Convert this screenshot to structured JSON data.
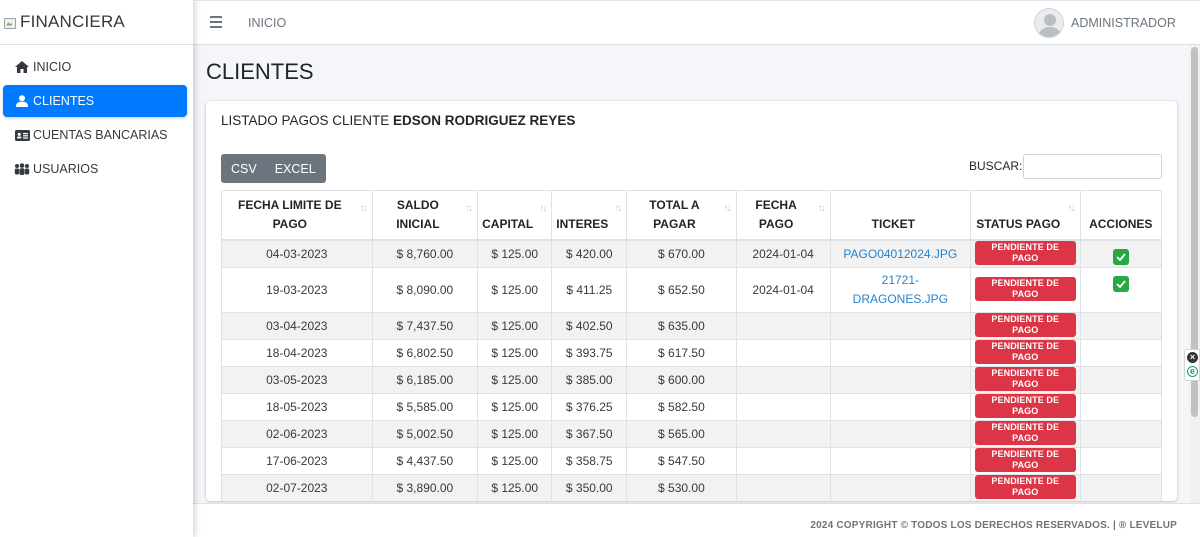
{
  "brand": {
    "name": "FINANCIERA"
  },
  "sidebar": {
    "items": [
      {
        "label": "INICIO",
        "icon": "home-icon",
        "active": false
      },
      {
        "label": "CLIENTES",
        "icon": "user-icon",
        "active": true
      },
      {
        "label": "CUENTAS BANCARIAS",
        "icon": "id-card-icon",
        "active": false
      },
      {
        "label": "USUARIOS",
        "icon": "users-icon",
        "active": false
      }
    ]
  },
  "topbar": {
    "breadcrumb": "INICIO",
    "user_name": "ADMINISTRADOR"
  },
  "page": {
    "title": "CLIENTES"
  },
  "card": {
    "header_prefix": "LISTADO PAGOS CLIENTE ",
    "client_name": "EDSON RODRIGUEZ REYES",
    "export_buttons": [
      "CSV",
      "EXCEL"
    ],
    "search": {
      "label": "BUSCAR:",
      "value": ""
    }
  },
  "table": {
    "columns": [
      [
        "FECHA LIMITE DE",
        "PAGO"
      ],
      [
        "SALDO",
        "INICIAL"
      ],
      [
        "CAPITAL"
      ],
      [
        "INTERES"
      ],
      [
        "TOTAL A",
        "PAGAR"
      ],
      [
        "FECHA",
        "PAGO"
      ],
      [
        "TICKET"
      ],
      [
        "STATUS PAGO"
      ],
      [
        "ACCIONES"
      ]
    ],
    "rows": [
      {
        "fecha_limite": "04-03-2023",
        "saldo": "$ 8,760.00",
        "capital": "$ 125.00",
        "interes": "$ 420.00",
        "total": "$ 670.00",
        "fecha_pago": "2024-01-04",
        "ticket": "PAGO04012024.JPG",
        "status": "PENDIENTE DE PAGO",
        "action": true
      },
      {
        "fecha_limite": "19-03-2023",
        "saldo": "$ 8,090.00",
        "capital": "$ 125.00",
        "interes": "$ 411.25",
        "total": "$ 652.50",
        "fecha_pago": "2024-01-04",
        "ticket": "21721-DRAGONES.JPG",
        "status": "PENDIENTE DE PAGO",
        "action": true
      },
      {
        "fecha_limite": "03-04-2023",
        "saldo": "$ 7,437.50",
        "capital": "$ 125.00",
        "interes": "$ 402.50",
        "total": "$ 635.00",
        "fecha_pago": "",
        "ticket": "",
        "status": "PENDIENTE DE PAGO",
        "action": false
      },
      {
        "fecha_limite": "18-04-2023",
        "saldo": "$ 6,802.50",
        "capital": "$ 125.00",
        "interes": "$ 393.75",
        "total": "$ 617.50",
        "fecha_pago": "",
        "ticket": "",
        "status": "PENDIENTE DE PAGO",
        "action": false
      },
      {
        "fecha_limite": "03-05-2023",
        "saldo": "$ 6,185.00",
        "capital": "$ 125.00",
        "interes": "$ 385.00",
        "total": "$ 600.00",
        "fecha_pago": "",
        "ticket": "",
        "status": "PENDIENTE DE PAGO",
        "action": false
      },
      {
        "fecha_limite": "18-05-2023",
        "saldo": "$ 5,585.00",
        "capital": "$ 125.00",
        "interes": "$ 376.25",
        "total": "$ 582.50",
        "fecha_pago": "",
        "ticket": "",
        "status": "PENDIENTE DE PAGO",
        "action": false
      },
      {
        "fecha_limite": "02-06-2023",
        "saldo": "$ 5,002.50",
        "capital": "$ 125.00",
        "interes": "$ 367.50",
        "total": "$ 565.00",
        "fecha_pago": "",
        "ticket": "",
        "status": "PENDIENTE DE PAGO",
        "action": false
      },
      {
        "fecha_limite": "17-06-2023",
        "saldo": "$ 4,437.50",
        "capital": "$ 125.00",
        "interes": "$ 358.75",
        "total": "$ 547.50",
        "fecha_pago": "",
        "ticket": "",
        "status": "PENDIENTE DE PAGO",
        "action": false
      },
      {
        "fecha_limite": "02-07-2023",
        "saldo": "$ 3,890.00",
        "capital": "$ 125.00",
        "interes": "$ 350.00",
        "total": "$ 530.00",
        "fecha_pago": "",
        "ticket": "",
        "status": "PENDIENTE DE PAGO",
        "action": false
      }
    ]
  },
  "footer": {
    "text": "2024 COPYRIGHT © TODOS LOS DERECHOS RESERVADOS. | ® LEVELUP"
  },
  "colors": {
    "primary": "#007bff",
    "danger": "#dc3545",
    "success": "#28a745",
    "secondary": "#6c757d"
  }
}
